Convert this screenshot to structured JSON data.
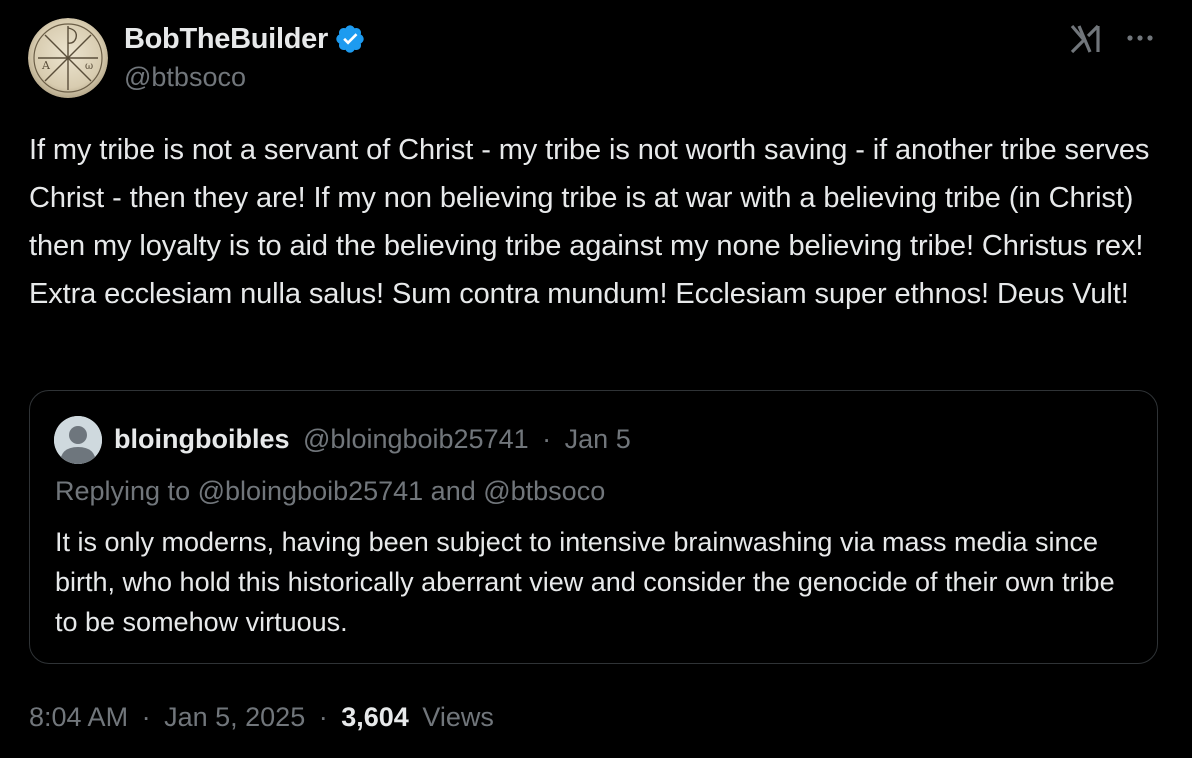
{
  "author": {
    "display_name": "BobTheBuilder",
    "handle": "@btbsoco",
    "verified": true,
    "avatar_icon": "chi-rho-seal-avatar"
  },
  "actions": {
    "grok_icon": "grok-icon",
    "more_icon": "more-options-icon"
  },
  "tweet": {
    "text": "If my tribe is not a servant of Christ - my tribe is not worth saving - if another tribe serves Christ - then they are! If my non believing tribe is at war with a believing tribe (in Christ) then my loyalty is to aid the believing tribe against my none believing tribe! Christus rex! Extra ecclesiam nulla salus! Sum contra mundum! Ecclesiam super ethnos! Deus Vult!"
  },
  "quote": {
    "display_name": "bloingboibles",
    "handle": "@bloingboib25741",
    "separator": "·",
    "date": "Jan 5",
    "replying_to": "Replying to @bloingboib25741 and @btbsoco",
    "text": "It is only moderns, having been subject to intensive brainwashing via mass media since birth, who hold this historically aberrant view and consider the genocide of their own tribe to be somehow virtuous."
  },
  "meta": {
    "time": "8:04 AM",
    "separator": "·",
    "date": "Jan 5, 2025",
    "views_count": "3,604",
    "views_label": "Views"
  },
  "colors": {
    "background": "#000000",
    "text_primary": "#e7e9ea",
    "text_secondary": "#71767b",
    "border": "#2f3336",
    "verified_blue": "#1d9bf0"
  }
}
